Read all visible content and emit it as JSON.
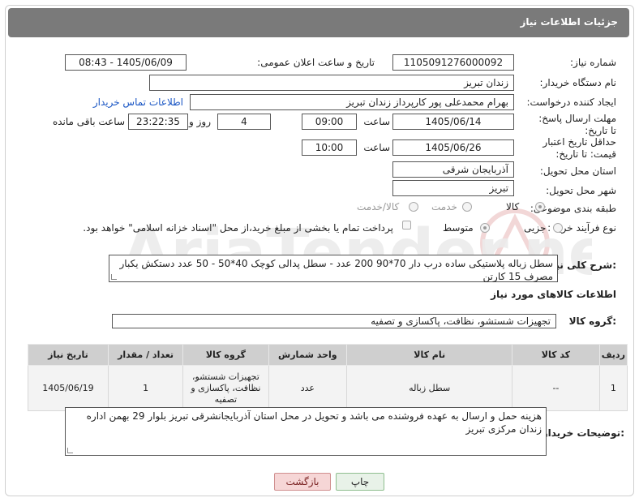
{
  "header": {
    "title": "جزئیات اطلاعات نیاز"
  },
  "fields": {
    "need_number_label": "شماره نیاز:",
    "need_number": "1105091276000092",
    "announce_label": "تاریخ و ساعت اعلان عمومی:",
    "announce_value": "1405/06/09 - 08:43",
    "buyer_org_label": "نام دستگاه خریدار:",
    "buyer_org": "زندان تبریز",
    "creator_label": "ایجاد کننده درخواست:",
    "creator": "بهرام محمدعلی پور کارپرداز زندان تبریز",
    "contact_link": "اطلاعات تماس خریدار",
    "deadline_label": "مهلت ارسال پاسخ: تا تاریخ:",
    "deadline_date": "1405/06/14",
    "time_word": "ساعت",
    "deadline_time": "09:00",
    "days_value": "4",
    "days_word": "روز و",
    "remaining_time": "23:22:35",
    "remaining_word": "ساعت باقی مانده",
    "validity_label": "حداقل تاریخ اعتبار قیمت: تا تاریخ:",
    "validity_date": "1405/06/26",
    "validity_time": "10:00",
    "province_label": "استان محل تحویل:",
    "province": "آذربایجان شرقی",
    "city_label": "شهر محل تحویل:",
    "city": "تبریز",
    "category_label": "طبقه بندی موضوعی:",
    "category_options": [
      "کالا",
      "خدمت",
      "کالا/خدمت"
    ],
    "process_label": "نوع فرآیند خرید :",
    "process_options": [
      "جزیی",
      "متوسط"
    ],
    "treasury_note": "پرداخت تمام یا بخشی از مبلغ خرید،از محل \"اسناد خزانه اسلامی\" خواهد بود."
  },
  "need_description": {
    "label": "شرح کلی نیاز:",
    "text": "سطل زباله پلاستیکی ساده درب دار 70*90 200 عدد -  سطل پدالی کوچک 40*50  - 50 عدد دستکش یکبار مصرف 15 کارتن"
  },
  "goods_section": {
    "title": "اطلاعات کالاهای مورد نیاز",
    "group_label": "گروه کالا:",
    "group_value": "تجهیزات شستشو، نظافت، پاکسازی و تصفیه"
  },
  "table": {
    "headers": [
      "ردیف",
      "کد کالا",
      "نام کالا",
      "واحد شمارش",
      "گروه کالا",
      "تعداد / مقدار",
      "تاریخ نیاز"
    ],
    "rows": [
      [
        "1",
        "--",
        "سطل زباله",
        "عدد",
        "تجهیزات شستشو، نظافت، پاکسازی و تصفیه",
        "1",
        "1405/06/19"
      ]
    ]
  },
  "buyer_notes": {
    "label": "توضیحات خریدار:",
    "text": "هزینه حمل و ارسال به عهده فروشنده می باشد و تحویل در محل استان آذربایجانشرقی تبریز بلوار 29 بهمن اداره زندان مرکزی تبریز"
  },
  "buttons": {
    "print": "چاپ",
    "back": "بازگشت"
  },
  "colors": {
    "header_bg": "#7a7a7a",
    "table_header_bg": "#cfcfcf",
    "link": "#1a56c4"
  }
}
